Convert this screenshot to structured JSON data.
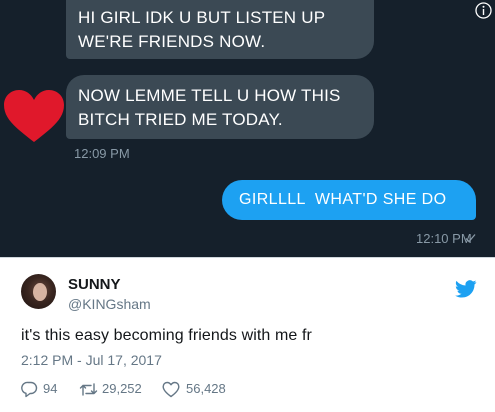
{
  "conversation": {
    "messages_in": [
      [
        "HI GIRL IDK U BUT LISTEN UP",
        "WE'RE FRIENDS NOW."
      ],
      [
        "NOW LEMME TELL U HOW THIS",
        "BITCH TRIED ME TODAY."
      ]
    ],
    "time_in": "12:09 PM",
    "message_out": "GIRLLLL  WHAT'D SHE DO",
    "time_out": "12:10 PM",
    "colors": {
      "background": "#15202b",
      "bubble_in": "#3b4954",
      "bubble_out": "#1da1f2",
      "heart": "#e0182b"
    }
  },
  "tweet": {
    "display_name": "SUNNY",
    "handle": "@KINGsham",
    "text": "it's this easy becoming friends with me fr",
    "timestamp": "2:12 PM - Jul 17, 2017",
    "replies": "94",
    "retweets": "29,252",
    "likes": "56,428",
    "brand_color": "#1da1f2"
  }
}
